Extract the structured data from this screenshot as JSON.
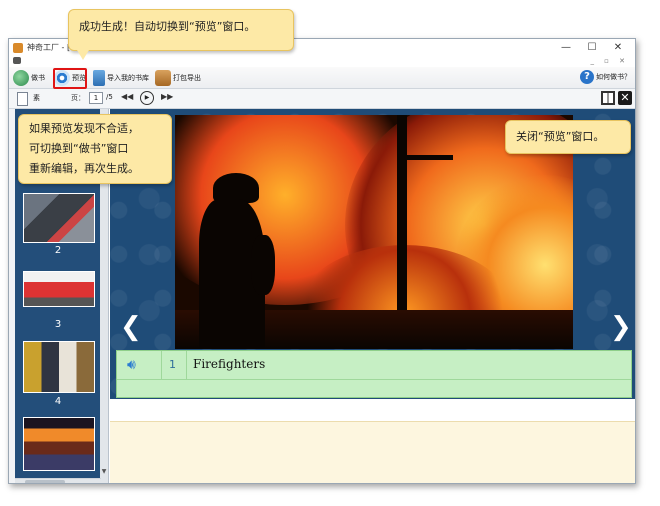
{
  "window": {
    "title": "神奇工厂 - [Fire",
    "controls": {
      "minimize": "—",
      "maximize": "☐",
      "close": "✕"
    },
    "sub_controls": "_ ▫ ✕"
  },
  "toolbar": {
    "make_book": "做书",
    "preview": "预览",
    "import_library": "导入我的书库",
    "pack_export": "打包导出",
    "help": "如何做书？"
  },
  "navbar": {
    "doc_label": "素",
    "page_label": "页：",
    "page_value": "1",
    "page_total": "/5",
    "prev": "◀◀",
    "play": "▶",
    "next": "▶▶",
    "close": "✕"
  },
  "thumbnails": [
    {
      "num": "2"
    },
    {
      "num": "3"
    },
    {
      "num": "4"
    }
  ],
  "caption": {
    "speaker_icon": "speaker-icon",
    "number": "1",
    "text": "Firefighters"
  },
  "stage": {
    "prev_arrow": "❮",
    "next_arrow": "❯"
  },
  "callouts": {
    "top": "成功生成！自动切换到“预览”窗口。",
    "left_lines": [
      "如果预览发现不合适，",
      "可切换到“做书”窗口",
      "重新编辑，再次生成。"
    ],
    "right": "关闭“预览”窗口。"
  },
  "colors": {
    "stage_bg": "#1f4c78",
    "caption_bg": "#c6efc4",
    "callout_bg": "#fde9a6",
    "highlight": "#e01414"
  }
}
